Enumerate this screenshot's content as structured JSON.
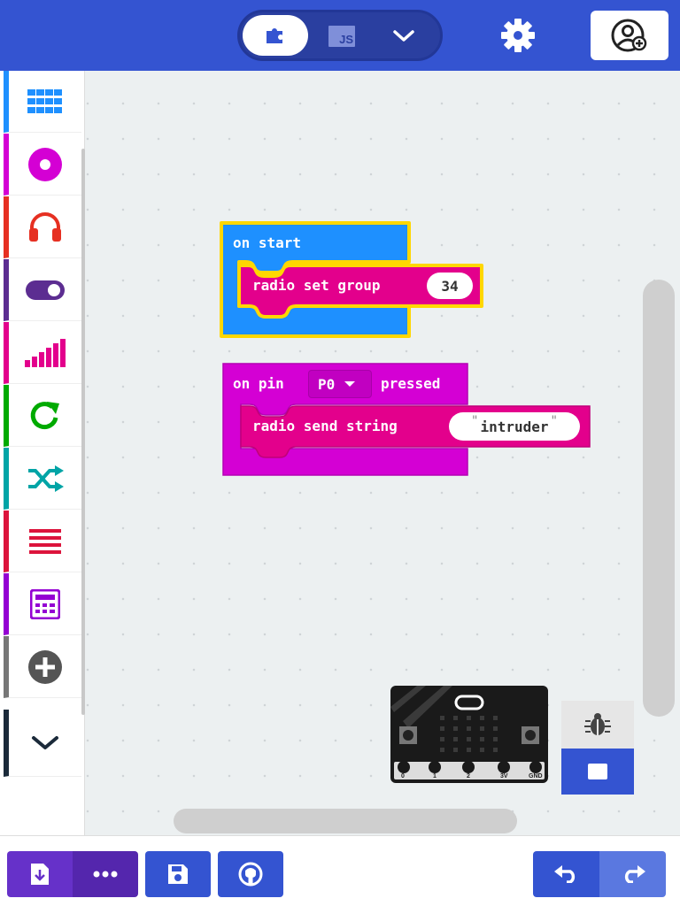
{
  "header": {
    "blocks_tab": "blocks-icon",
    "js_tab": "JS",
    "more_tab": "chevron-down-icon",
    "settings": "gear-icon",
    "user": "user-add-icon"
  },
  "toolbox": {
    "categories": [
      {
        "name": "basic",
        "icon": "grid-icon",
        "color": "#1e90ff"
      },
      {
        "name": "input",
        "icon": "target-icon",
        "color": "#d400d4"
      },
      {
        "name": "music",
        "icon": "headphones-icon",
        "color": "#e63022"
      },
      {
        "name": "led",
        "icon": "toggle-icon",
        "color": "#5c2d91"
      },
      {
        "name": "radio",
        "icon": "signal-icon",
        "color": "#e3008c"
      },
      {
        "name": "loops",
        "icon": "loop-icon",
        "color": "#00aa00"
      },
      {
        "name": "logic",
        "icon": "shuffle-icon",
        "color": "#00a4a6"
      },
      {
        "name": "variables",
        "icon": "lines-icon",
        "color": "#dc143c"
      },
      {
        "name": "math",
        "icon": "calculator-icon",
        "color": "#9400d3"
      },
      {
        "name": "extensions",
        "icon": "plus-circle-icon",
        "color": "#777777"
      },
      {
        "name": "advanced",
        "icon": "chevron-down-icon",
        "color": "#1b2a3a"
      }
    ]
  },
  "blocks": {
    "on_start": {
      "label": "on start",
      "color": "#1e90ff",
      "highlight": "#ffd700"
    },
    "radio_set_group": {
      "label": "radio set group",
      "value": "34",
      "color": "#e3008c"
    },
    "on_pin": {
      "label_on_pin": "on pin",
      "pin": "P0",
      "label_pressed": "pressed",
      "color": "#d400d4"
    },
    "radio_send_string": {
      "label": "radio send string",
      "value": "intruder",
      "color": "#e3008c"
    }
  },
  "simulator": {
    "pins": [
      "0",
      "1",
      "2",
      "3V",
      "GND"
    ],
    "debug": "bug-icon",
    "stop": "stop-icon"
  },
  "bottombar": {
    "download": "download-icon",
    "more": "dots-icon",
    "save": "save-icon",
    "github": "github-icon",
    "undo": "undo-icon",
    "redo": "redo-icon"
  }
}
